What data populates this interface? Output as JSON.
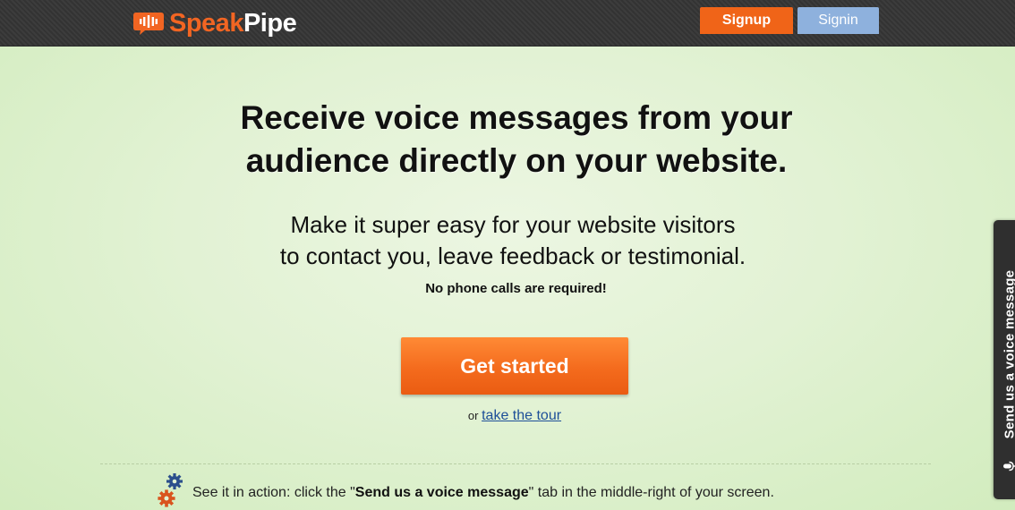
{
  "header": {
    "logo_part1": "Speak",
    "logo_part2": "Pipe",
    "signup_label": "Signup",
    "signin_label": "Signin"
  },
  "hero": {
    "headline_line1": "Receive voice messages from your",
    "headline_line2": "audience directly on your website.",
    "subline_line1": "Make it super easy for your website visitors",
    "subline_line2": "to contact you, leave feedback or testimonial.",
    "no_phone": "No phone calls are required!",
    "cta_label": "Get started",
    "tour_prefix": "or",
    "tour_link": "take the tour"
  },
  "footer_hint": {
    "text_before": "See it in action: click the \"",
    "text_bold": "Send us a voice message",
    "text_after": "\" tab in the middle-right of your screen."
  },
  "side_tab": {
    "label": "Send us a voice message"
  },
  "colors": {
    "brand_orange": "#f26522",
    "signup_bg": "#f06418",
    "signin_bg": "#8eb1dd",
    "topbar_bg": "#363636",
    "page_bg": "#e2f2d4",
    "link": "#1d4f98"
  },
  "icons": [
    "speech-bubble-sound-icon",
    "gears-icon",
    "microphone-icon"
  ]
}
